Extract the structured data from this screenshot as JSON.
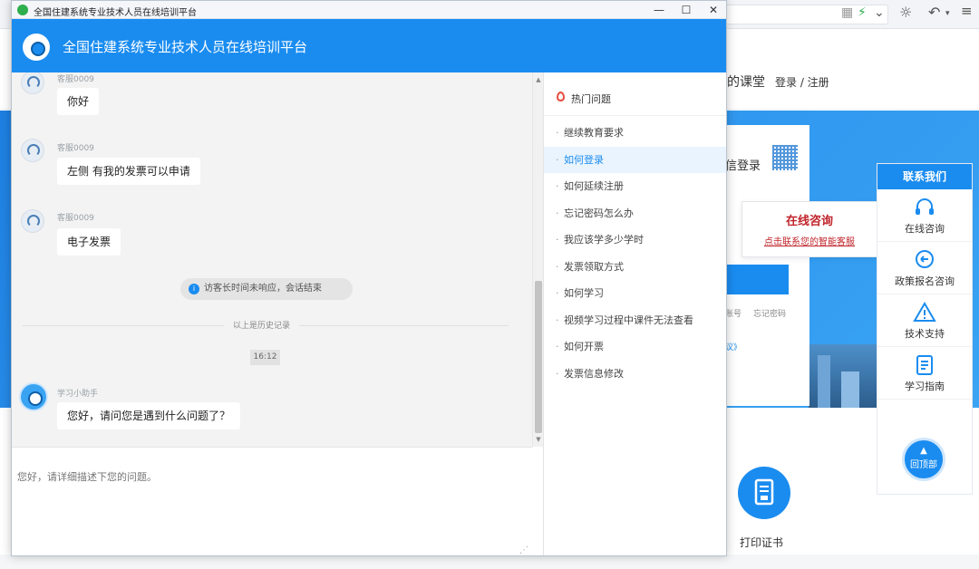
{
  "window": {
    "title": "全国住建系统专业技术人员在线培训平台",
    "header_title": "全国住建系统专业技术人员在线培训平台"
  },
  "chat": {
    "messages": [
      {
        "sender": "客服0009",
        "text": "你好"
      },
      {
        "sender": "客服0009",
        "text": "左侧 有我的发票可以申请"
      },
      {
        "sender": "客服0009",
        "text": "电子发票"
      }
    ],
    "system_notice": "访客长时间未响应，会话结束",
    "history_label": "以上是历史记录",
    "time": "16:12",
    "bot_message": {
      "sender": "学习小助手",
      "text": "您好，请问您是遇到什么问题了？"
    },
    "input_placeholder": "您好，请详细描述下您的问题。"
  },
  "faq": {
    "title": "热门问题",
    "items": [
      "继续教育要求",
      "如何登录",
      "如何延续注册",
      "忘记密码怎么办",
      "我应该学多少学时",
      "发票领取方式",
      "如何学习",
      "视频学习过程中课件无法查看",
      "如何开票",
      "发票信息修改"
    ],
    "active_index": 1
  },
  "background_page": {
    "nav_partial": "的课堂",
    "login_register": "登录 / 注册",
    "login_title_partial": "信登录",
    "login_small_left": "账号",
    "login_small_right": "忘记密码",
    "login_agreement_partial": "议》",
    "consult_popup": {
      "title": "在线咨询",
      "link": "点击联系您的智能客服"
    },
    "contact_panel": {
      "title": "联系我们",
      "items": [
        {
          "label": "在线咨询",
          "icon": "headset-icon"
        },
        {
          "label": "政策报名咨询",
          "icon": "chat-back-icon"
        },
        {
          "label": "技术支持",
          "icon": "warning-icon"
        },
        {
          "label": "学习指南",
          "icon": "guide-icon"
        }
      ]
    },
    "back_to_top": "回顶部",
    "print_cert": "打印证书"
  },
  "colors": {
    "brand_blue": "#1a8cf0",
    "consult_red": "#c0242b",
    "chat_bg": "#f3f3f3"
  }
}
